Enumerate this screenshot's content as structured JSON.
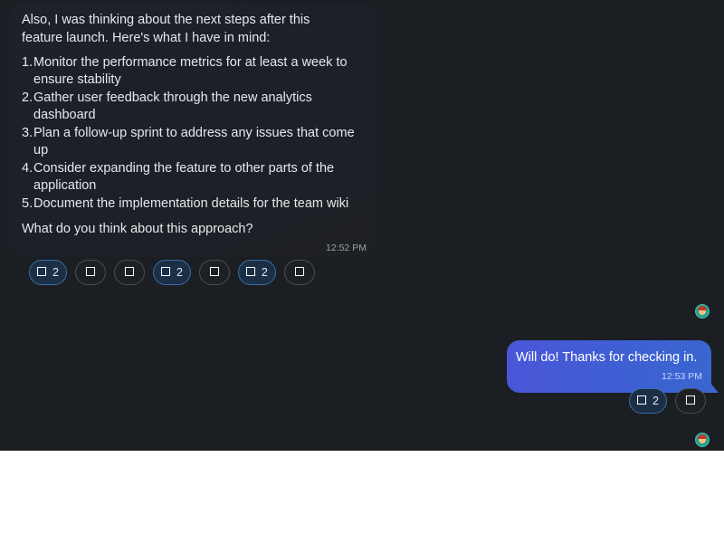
{
  "incoming_message": {
    "intro": "Also, I was thinking about the next steps after this feature launch. Here's what I have in mind:",
    "steps": [
      {
        "num": "1.",
        "text": "Monitor the performance metrics for at least a week to ensure stability"
      },
      {
        "num": "2.",
        "text": "Gather user feedback through the new analytics dashboard"
      },
      {
        "num": "3.",
        "text": "Plan a follow-up sprint to address any issues that come up"
      },
      {
        "num": "4.",
        "text": "Consider expanding the feature to other parts of the application"
      },
      {
        "num": "5.",
        "text": "Document the implementation details for the team wiki"
      }
    ],
    "question": "What do you think about this approach?",
    "time": "12:52 PM",
    "reactions": [
      {
        "count": "2",
        "active": true
      },
      {
        "count": "",
        "active": false
      },
      {
        "count": "",
        "active": false
      },
      {
        "count": "2",
        "active": true
      },
      {
        "count": "",
        "active": false
      },
      {
        "count": "2",
        "active": true
      },
      {
        "count": "",
        "active": false
      }
    ]
  },
  "outgoing_message": {
    "text": "Will do! Thanks for checking in.",
    "time": "12:53 PM",
    "reactions": [
      {
        "count": "2",
        "active": true
      },
      {
        "count": "",
        "active": false
      }
    ]
  },
  "icons": {
    "reaction_emoji": "emoji-square-icon",
    "avatar": "user-avatar"
  },
  "colors": {
    "chat_background": "#1b1e22",
    "outgoing_bubble": "#4a56d8",
    "active_reaction_border": "#3b6ea4"
  }
}
